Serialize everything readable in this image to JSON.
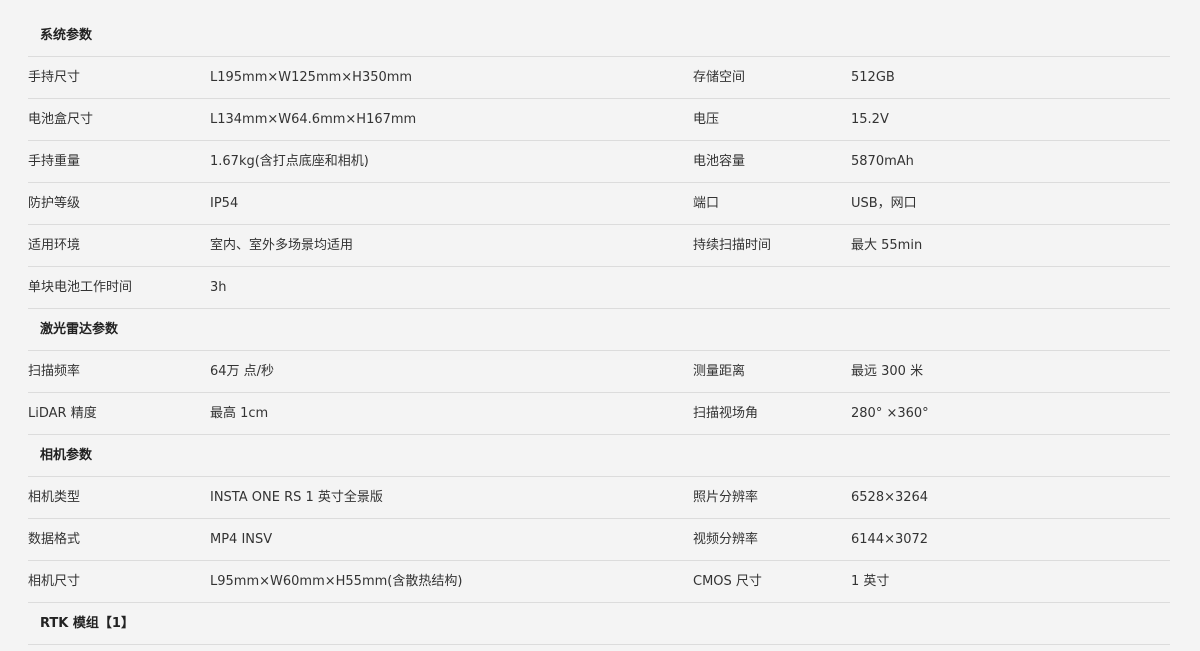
{
  "sections": [
    {
      "title": "系统参数",
      "rows": [
        [
          "手持尺寸",
          " L195mm×W125mm×H350mm",
          "存储空间",
          "512GB"
        ],
        [
          "电池盒尺寸",
          " L134mm×W64.6mm×H167mm",
          "电压",
          " 15.2V"
        ],
        [
          "手持重量",
          "1.67kg(含打点底座和相机)",
          "电池容量",
          " 5870mAh"
        ],
        [
          "防护等级",
          "IP54",
          "端口",
          "USB，网口"
        ],
        [
          "适用环境",
          "室内、室外多场景均适用",
          "持续扫描时间",
          "最大 55min"
        ],
        [
          "单块电池工作时间",
          "3h",
          "",
          ""
        ]
      ]
    },
    {
      "title": "激光雷达参数",
      "rows": [
        [
          "扫描频率",
          "64万 点/秒",
          " 测量距离",
          " 最远 300 米"
        ],
        [
          "LiDAR 精度",
          "最高 1cm",
          "扫描视场角",
          "280° ×360°"
        ]
      ]
    },
    {
      "title": "相机参数",
      "rows": [
        [
          "相机类型",
          "INSTA ONE RS 1 英寸全景版",
          "照片分辨率",
          "6528×3264"
        ],
        [
          "数据格式",
          " MP4 INSV",
          "视频分辨率",
          "6144×3072"
        ],
        [
          "相机尺寸",
          "L95mm×W60mm×H55mm(含散热结构)",
          "CMOS 尺寸",
          " 1 英寸"
        ]
      ]
    },
    {
      "title": "RTK 模组【1】",
      "rows": []
    }
  ]
}
